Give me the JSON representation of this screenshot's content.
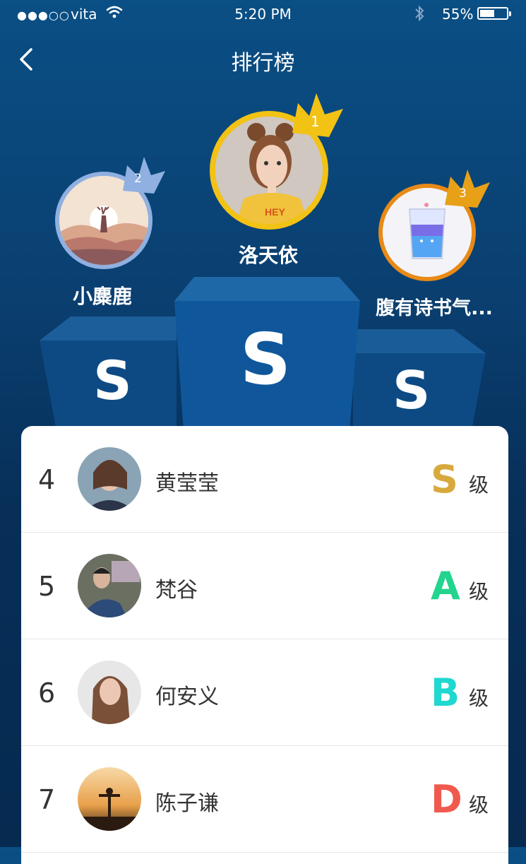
{
  "status_bar": {
    "signal": "●●●○○",
    "carrier": "vita",
    "time": "5:20 PM",
    "battery": "55%",
    "battery_level": 0.55
  },
  "nav": {
    "title": "排行榜"
  },
  "podium": [
    {
      "rank": "2",
      "name": "小麋鹿",
      "grade": "S"
    },
    {
      "rank": "1",
      "name": "洛天依",
      "grade": "S"
    },
    {
      "rank": "3",
      "name": "腹有诗书气...",
      "grade": "S"
    }
  ],
  "ranking": [
    {
      "rank": "4",
      "name": "黄莹莹",
      "grade": "S",
      "grade_suffix": "级",
      "grade_color": "#d8a93c"
    },
    {
      "rank": "5",
      "name": "梵谷",
      "grade": "A",
      "grade_suffix": "级",
      "grade_color": "#22d48e"
    },
    {
      "rank": "6",
      "name": "何安义",
      "grade": "B",
      "grade_suffix": "级",
      "grade_color": "#1fd8d0"
    },
    {
      "rank": "7",
      "name": "陈子谦",
      "grade": "D",
      "grade_suffix": "级",
      "grade_color": "#f05a4e"
    }
  ],
  "colors": {
    "background": "#0a4f85",
    "silver_ring": "#8fb0e0",
    "gold_ring": "#f2c215",
    "bronze_ring": "#e88a17"
  }
}
